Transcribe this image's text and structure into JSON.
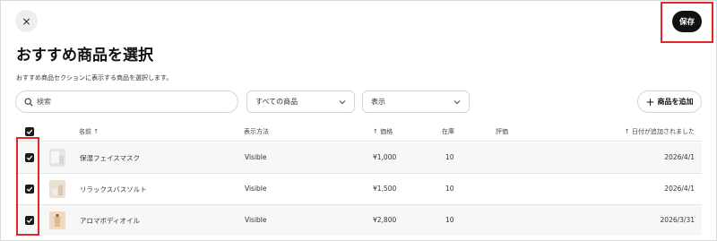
{
  "header": {
    "close_label": "×",
    "save_label": "保存",
    "title": "おすすめ商品を選択",
    "subtitle": "おすすめ商品セクションに表示する商品を選択します。"
  },
  "toolbar": {
    "search_placeholder": "検索",
    "filter_value": "すべての商品",
    "view_value": "表示",
    "add_plus": "+",
    "add_label": "商品を追加"
  },
  "table": {
    "columns": {
      "name": "名前 ↑",
      "display": "表示方法",
      "price": "↑ 価格",
      "stock": "在庫",
      "rating": "評価",
      "date_added": "↑ 日付が追加されました"
    },
    "rows": [
      {
        "name": "保湿フェイスマスク",
        "display": "Visible",
        "price": "¥1,000",
        "stock": "10",
        "rating": "",
        "date": "2026/4/1",
        "checked": true,
        "thumb_color": "#e7e5e2"
      },
      {
        "name": "リラックスバスソルト",
        "display": "Visible",
        "price": "¥1,500",
        "stock": "10",
        "rating": "",
        "date": "2026/4/1",
        "checked": true,
        "thumb_color": "#eadfd3"
      },
      {
        "name": "アロマボディオイル",
        "display": "Visible",
        "price": "¥2,800",
        "stock": "10",
        "rating": "",
        "date": "2026/3/31",
        "checked": true,
        "thumb_color": "#efd9c4"
      }
    ]
  },
  "colors": {
    "accent": "#111111",
    "highlight": "#e3262a",
    "row_alt": "#f7f7f7"
  }
}
